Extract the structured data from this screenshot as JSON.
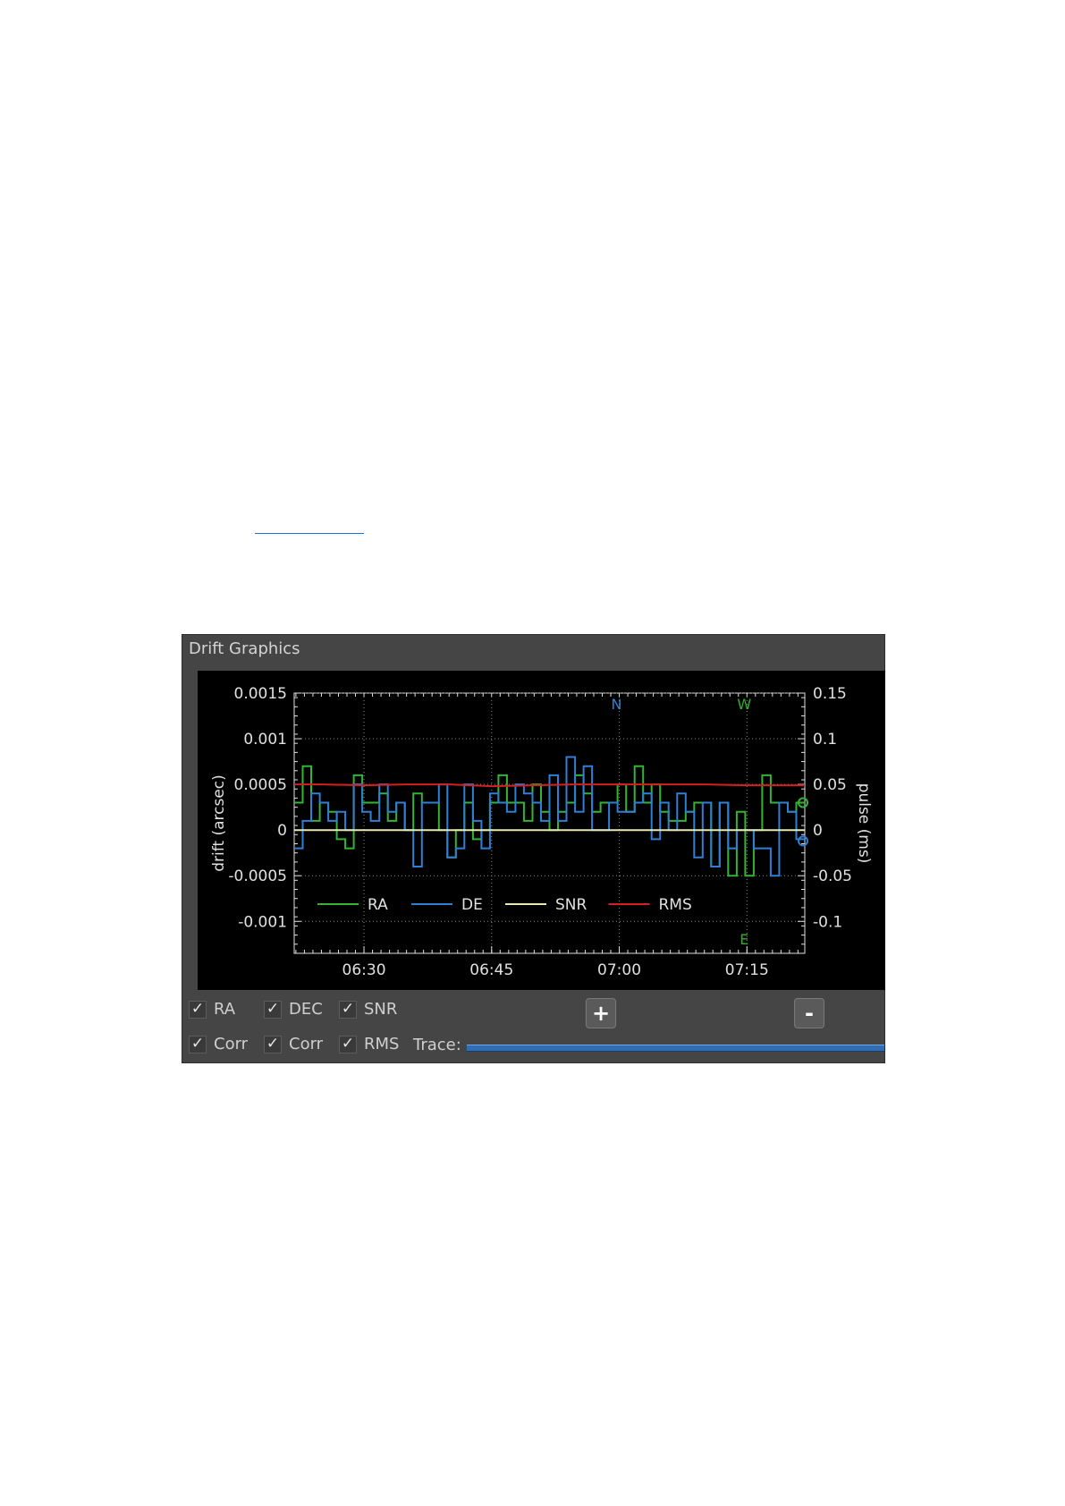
{
  "panel": {
    "title": "Drift Graphics"
  },
  "chart_data": {
    "type": "line",
    "left_axis": {
      "label": "drift (arcsec)",
      "ticks": [
        "0.0015",
        "0.001",
        "0.0005",
        "0",
        "-0.0005",
        "-0.001"
      ],
      "tick_values": [
        0.0015,
        0.001,
        0.0005,
        0,
        -0.0005,
        -0.001
      ],
      "ylim": [
        -0.00135,
        0.0015
      ]
    },
    "right_axis": {
      "label": "pulse (ms)",
      "ticks": [
        "0.15",
        "0.1",
        "0.05",
        "0",
        "-0.05",
        "-0.1"
      ],
      "tick_values": [
        0.15,
        0.1,
        0.05,
        0,
        -0.05,
        -0.1
      ]
    },
    "x_axis": {
      "ticks": [
        "06:30",
        "06:45",
        "07:00",
        "07:15"
      ],
      "tick_minutes": [
        390,
        405,
        420,
        435
      ],
      "xlim": [
        381.8,
        441.8
      ]
    },
    "markers": [
      {
        "label": "N",
        "minute": 420,
        "color": "#2f7fd6"
      },
      {
        "label": "W",
        "minute": 435,
        "color": "#2fae2f"
      },
      {
        "label": "E",
        "minute": 435,
        "color": "#2fae2f"
      }
    ],
    "legend": {
      "placement": "bottom",
      "entries": [
        {
          "name": "RA",
          "color": "#34b334"
        },
        {
          "name": "DE",
          "color": "#2f7fd6"
        },
        {
          "name": "SNR",
          "color": "#e8e8b0"
        },
        {
          "name": "RMS",
          "color": "#d42020"
        }
      ]
    },
    "grid": true,
    "series": [
      {
        "name": "RA",
        "color": "#34b334",
        "step": true,
        "x": [
          381.8,
          382.8,
          383.8,
          384.8,
          385.8,
          386.8,
          387.8,
          388.8,
          389.8,
          390.8,
          391.8,
          392.8,
          393.8,
          394.8,
          395.8,
          396.8,
          397.8,
          398.8,
          399.8,
          400.8,
          401.8,
          402.8,
          403.8,
          404.8,
          405.8,
          406.8,
          407.8,
          408.8,
          409.8,
          410.8,
          411.8,
          412.8,
          413.8,
          414.8,
          415.8,
          416.8,
          417.8,
          418.8,
          419.8,
          420.8,
          421.8,
          422.8,
          423.8,
          424.8,
          425.8,
          426.8,
          427.8,
          428.8,
          429.8,
          430.8,
          431.8,
          432.8,
          433.8,
          434.8,
          435.8,
          436.8,
          437.8,
          438.8,
          439.8,
          440.8
        ],
        "values": [
          0.0003,
          0.0007,
          0.0001,
          0.0003,
          0.0002,
          -0.0001,
          -0.0002,
          0.0006,
          0.0003,
          0.0003,
          0.0004,
          0.0001,
          0.0003,
          0.0,
          0.0004,
          0.0003,
          0.0003,
          0.0,
          -0.0003,
          0.0,
          0.0003,
          -0.0001,
          0.0,
          0.0003,
          0.0006,
          0.0003,
          0.0003,
          0.0001,
          0.0005,
          0.0002,
          0.0,
          0.0002,
          0.0003,
          0.0006,
          0.0004,
          0.0002,
          0.0003,
          0.0003,
          0.0005,
          0.0002,
          0.0007,
          0.0003,
          0.0005,
          0.0002,
          0.0001,
          0.0001,
          0.0002,
          0.0003,
          0.0003,
          -0.0004,
          0.0003,
          -0.0005,
          0.0002,
          -0.0005,
          0.0,
          0.0006,
          0.0003,
          0.0003,
          0.0002,
          0.0003
        ]
      },
      {
        "name": "DE",
        "color": "#2f7fd6",
        "step": true,
        "x": [
          381.8,
          382.8,
          383.8,
          384.8,
          385.8,
          386.8,
          387.8,
          388.8,
          389.8,
          390.8,
          391.8,
          392.8,
          393.8,
          394.8,
          395.8,
          396.8,
          397.8,
          398.8,
          399.8,
          400.8,
          401.8,
          402.8,
          403.8,
          404.8,
          405.8,
          406.8,
          407.8,
          408.8,
          409.8,
          410.8,
          411.8,
          412.8,
          413.8,
          414.8,
          415.8,
          416.8,
          417.8,
          418.8,
          419.8,
          420.8,
          421.8,
          422.8,
          423.8,
          424.8,
          425.8,
          426.8,
          427.8,
          428.8,
          429.8,
          430.8,
          431.8,
          432.8,
          433.8,
          434.8,
          435.8,
          436.8,
          437.8,
          438.8,
          439.8,
          440.8
        ],
        "values": [
          -0.0002,
          0.0001,
          0.0004,
          0.0003,
          0.0001,
          0.0002,
          0.0,
          0.0005,
          0.0002,
          0.0001,
          0.0005,
          0.0002,
          0.0003,
          0.0,
          -0.0004,
          0.0003,
          0.0003,
          0.0005,
          -0.0003,
          -0.0002,
          0.0005,
          0.0001,
          -0.0002,
          0.0004,
          0.0003,
          0.0002,
          0.0005,
          0.0004,
          0.0003,
          0.0001,
          0.0006,
          0.0001,
          0.0008,
          0.0002,
          0.0007,
          0.0,
          0.0,
          0.0003,
          0.0002,
          0.0002,
          0.0003,
          0.0004,
          -0.0001,
          0.0003,
          0.0,
          0.0004,
          0.0002,
          -0.0003,
          0.0003,
          -0.0004,
          0.0003,
          -0.0002,
          0.0,
          0.0,
          -0.0002,
          -0.0002,
          -0.0005,
          0.0003,
          0.0002,
          -0.0001
        ]
      },
      {
        "name": "SNR",
        "color": "#e8e8b0",
        "x": [
          381.8,
          441.8
        ],
        "values": [
          0.0,
          0.0
        ]
      },
      {
        "name": "RMS",
        "color": "#d42020",
        "x": [
          381.8,
          385,
          390,
          395,
          400,
          405,
          410,
          415,
          420,
          425,
          430,
          435,
          441.8
        ],
        "values": [
          0.0005,
          0.0005,
          0.00049,
          0.0005,
          0.0005,
          0.00048,
          0.00049,
          0.0005,
          0.0005,
          0.0005,
          0.0005,
          0.00049,
          0.00049
        ]
      }
    ]
  },
  "controls": {
    "row1": [
      {
        "label": "RA",
        "checked": true
      },
      {
        "label": "DEC",
        "checked": true
      },
      {
        "label": "SNR",
        "checked": true
      }
    ],
    "row2": [
      {
        "label": "Corr",
        "checked": true
      },
      {
        "label": "Corr",
        "checked": true
      },
      {
        "label": "RMS",
        "checked": true
      }
    ],
    "check_glyph": "✓",
    "zoom_in_label": "+",
    "zoom_out_label": "-",
    "trace_label": "Trace:"
  }
}
